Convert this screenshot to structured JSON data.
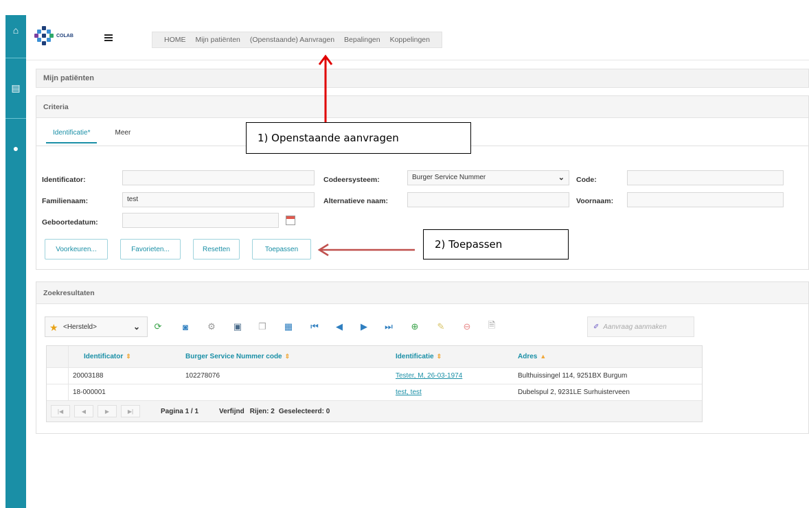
{
  "app": {
    "logo_text": "COLAB",
    "nav": [
      "HOME",
      "Mijn patiënten",
      "(Openstaande) Aanvragen",
      "Bepalingen",
      "Koppelingen"
    ]
  },
  "rail": {
    "icons": [
      "home-icon",
      "list-icon",
      "user-icon"
    ]
  },
  "page_title": "Mijn patiënten",
  "criteria": {
    "title": "Criteria",
    "tabs": [
      "Identificatie*",
      "Meer"
    ],
    "fields": {
      "identificator_label": "Identificator:",
      "identificator_value": "",
      "codeersysteem_label": "Codeersysteem:",
      "codeersysteem_value": "Burger Service Nummer",
      "code_label": "Code:",
      "code_value": "",
      "familienaam_label": "Familienaam:",
      "familienaam_value": "test",
      "alternatieve_naam_label": "Alternatieve naam:",
      "alternatieve_naam_value": "",
      "voornaam_label": "Voornaam:",
      "voornaam_value": "",
      "geboortedatum_label": "Geboortedatum:",
      "geboortedatum_value": ""
    },
    "buttons": [
      "Voorkeuren...",
      "Favorieten...",
      "Resetten",
      "Toepassen"
    ]
  },
  "results": {
    "title": "Zoekresultaten",
    "view_select": "<Hersteld>",
    "create_button": "Aanvraag aanmaken",
    "columns": [
      "Identificator",
      "Burger Service Nummer code",
      "Identificatie",
      "Adres"
    ],
    "rows": [
      {
        "identificator": "20003188",
        "bsn": "102278076",
        "identificatie": "Tester, M, 26-03-1974",
        "adres": "Bulthuissingel 114, 9251BX Burgum"
      },
      {
        "identificator": "18-000001",
        "bsn": "",
        "identificatie": "test, test",
        "adres": "Dubelspul 2, 9231LE Surhuisterveen"
      }
    ],
    "footer": {
      "page": "Pagina 1 / 1",
      "refine": "Verfijnd",
      "rows": "Rijen: 2",
      "selected": "Geselecteerd: 0"
    }
  },
  "annotations": {
    "step1": "1) Openstaande aanvragen",
    "step2": "2) Toepassen"
  },
  "colors": {
    "accent": "#1a8fa6",
    "annotation_arrow": "#e00000"
  }
}
